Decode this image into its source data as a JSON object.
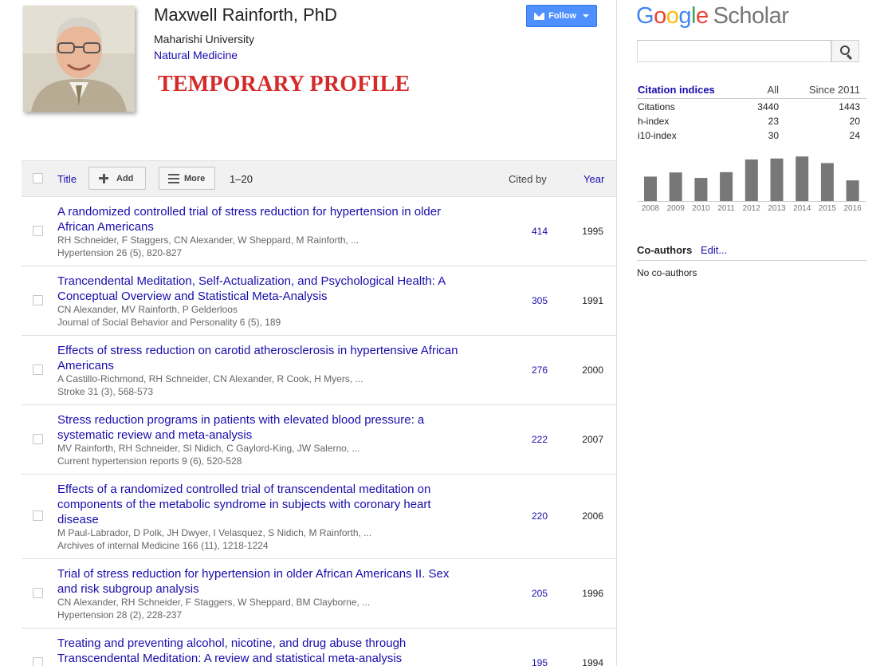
{
  "profile": {
    "name": "Maxwell Rainforth, PhD",
    "affiliation": "Maharishi University",
    "field": "Natural Medicine",
    "overlay_text": "TEMPORARY PROFILE",
    "follow_label": "Follow"
  },
  "toolbar": {
    "title_label": "Title",
    "add_label": "Add",
    "more_label": "More",
    "range": "1–20",
    "cited_by_label": "Cited by",
    "year_label": "Year"
  },
  "articles": [
    {
      "title": "A randomized controlled trial of stress reduction for hypertension in older African Americans",
      "authors": "RH Schneider, F Staggers, CN Alexander, W Sheppard, M Rainforth, ...",
      "venue": "Hypertension 26 (5), 820-827",
      "cited_by": "414",
      "year": "1995"
    },
    {
      "title": "Trancendental Meditation, Self-Actualization, and Psychological Health: A Conceptual Overview and Statistical Meta-Analysis",
      "authors": "CN Alexander, MV Rainforth, P Gelderloos",
      "venue": "Journal of Social Behavior and Personality 6 (5), 189",
      "cited_by": "305",
      "year": "1991"
    },
    {
      "title": "Effects of stress reduction on carotid atherosclerosis in hypertensive African Americans",
      "authors": "A Castillo-Richmond, RH Schneider, CN Alexander, R Cook, H Myers, ...",
      "venue": "Stroke 31 (3), 568-573",
      "cited_by": "276",
      "year": "2000"
    },
    {
      "title": "Stress reduction programs in patients with elevated blood pressure: a systematic review and meta-analysis",
      "authors": "MV Rainforth, RH Schneider, SI Nidich, C Gaylord-King, JW Salerno, ...",
      "venue": "Current hypertension reports 9 (6), 520-528",
      "cited_by": "222",
      "year": "2007"
    },
    {
      "title": "Effects of a randomized controlled trial of transcendental meditation on components of the metabolic syndrome in subjects with coronary heart disease",
      "authors": "M Paul-Labrador, D Polk, JH Dwyer, I Velasquez, S Nidich, M Rainforth, ...",
      "venue": "Archives of internal Medicine 166 (11), 1218-1224",
      "cited_by": "220",
      "year": "2006"
    },
    {
      "title": "Trial of stress reduction for hypertension in older African Americans II. Sex and risk subgroup analysis",
      "authors": "CN Alexander, RH Schneider, F Staggers, W Sheppard, BM Clayborne, ...",
      "venue": "Hypertension 28 (2), 228-237",
      "cited_by": "205",
      "year": "1996"
    },
    {
      "title": "Treating and preventing alcohol, nicotine, and drug abuse through Transcendental Meditation: A review and statistical meta-analysis",
      "authors": "",
      "venue": "",
      "cited_by": "195",
      "year": "1994"
    }
  ],
  "sidebar": {
    "logo_google": "Google",
    "logo_scholar": "Scholar",
    "search_placeholder": "",
    "citation_indices": {
      "title": "Citation indices",
      "col_all": "All",
      "col_since": "Since 2011",
      "rows": [
        {
          "label": "Citations",
          "all": "3440",
          "since": "1443"
        },
        {
          "label": "h-index",
          "all": "23",
          "since": "20"
        },
        {
          "label": "i10-index",
          "all": "30",
          "since": "24"
        }
      ]
    },
    "coauthors": {
      "title": "Co-authors",
      "edit_label": "Edit...",
      "empty_text": "No co-authors"
    }
  },
  "chart_data": {
    "type": "bar",
    "categories": [
      "2008",
      "2009",
      "2010",
      "2011",
      "2012",
      "2013",
      "2014",
      "2015",
      "2016"
    ],
    "values": [
      148,
      173,
      140,
      175,
      252,
      258,
      270,
      230,
      125
    ],
    "title": "",
    "xlabel": "",
    "ylabel": "",
    "ylim": [
      0,
      300
    ],
    "bar_color": "#777777"
  },
  "colors": {
    "link": "#1a0dab",
    "follow_button": "#4d90fe",
    "overlay_red": "#d42a2a",
    "toolbar_bg": "#f1f1f1"
  }
}
